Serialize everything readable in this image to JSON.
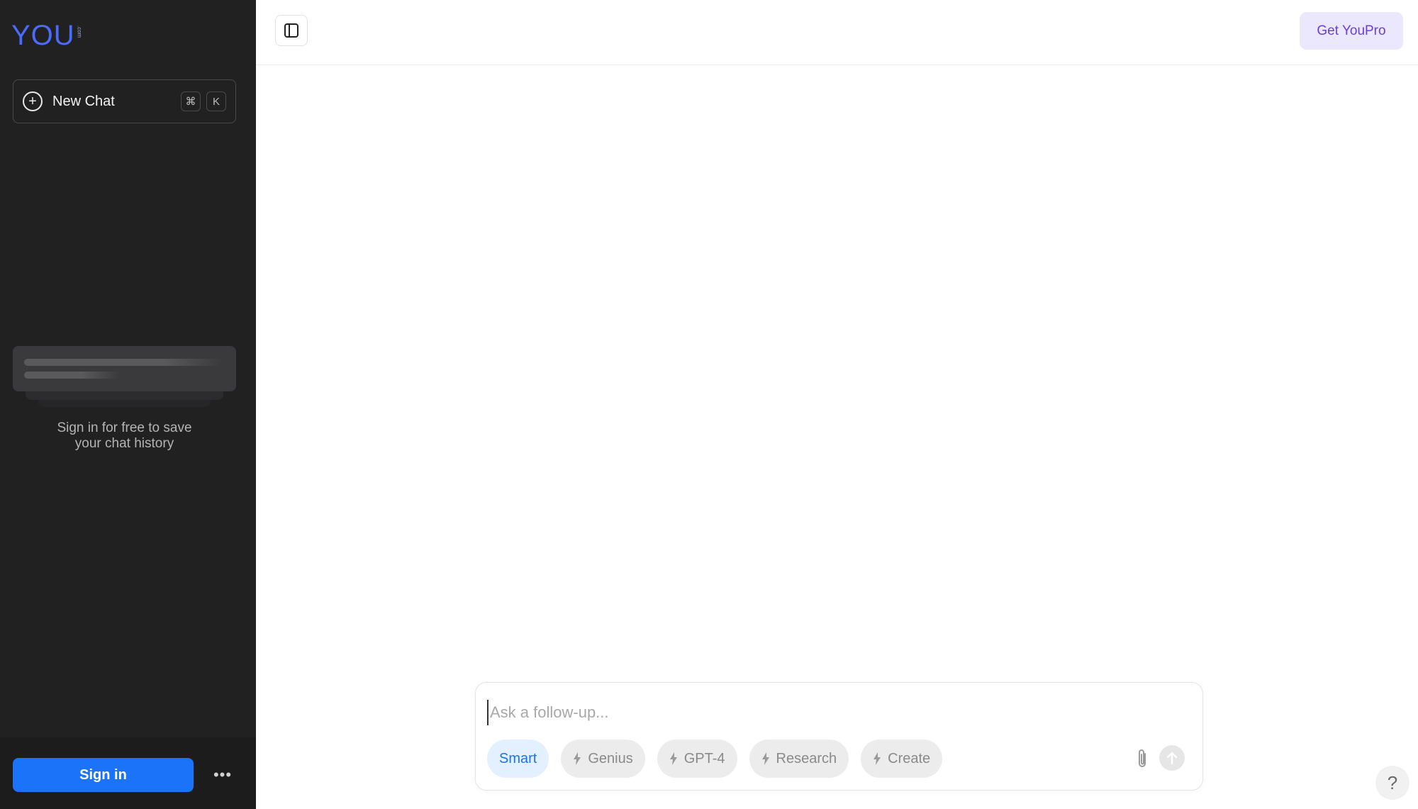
{
  "logo": {
    "text": "YOU",
    "suffix": ".com"
  },
  "sidebar": {
    "new_chat_label": "New Chat",
    "shortcut_keys": [
      "⌘",
      "K"
    ],
    "signin_message_line1": "Sign in for free to save",
    "signin_message_line2": "your chat history",
    "signin_label": "Sign in",
    "more_label": "•••"
  },
  "header": {
    "youpro_label": "Get YouPro"
  },
  "composer": {
    "placeholder": "Ask a follow-up...",
    "modes": [
      {
        "label": "Smart",
        "active": true
      },
      {
        "label": "Genius",
        "active": false
      },
      {
        "label": "GPT-4",
        "active": false
      },
      {
        "label": "Research",
        "active": false
      },
      {
        "label": "Create",
        "active": false
      }
    ]
  },
  "help_label": "?",
  "colors": {
    "sidebar_bg": "#212122",
    "brand_blue": "#4b6bfb",
    "signin_blue": "#1a73f8",
    "youpro_bg": "#ebe8fd",
    "youpro_text": "#6a3ed8",
    "active_mode_bg": "#e2f0ff",
    "active_mode_text": "#1e73e6"
  },
  "icons": {
    "new_chat": "plus-circle-icon",
    "sidebar_toggle": "sidebar-panel-icon",
    "mode": "bolt-icon",
    "attach": "paperclip-icon",
    "send": "arrow-up-icon",
    "help": "question-icon"
  }
}
